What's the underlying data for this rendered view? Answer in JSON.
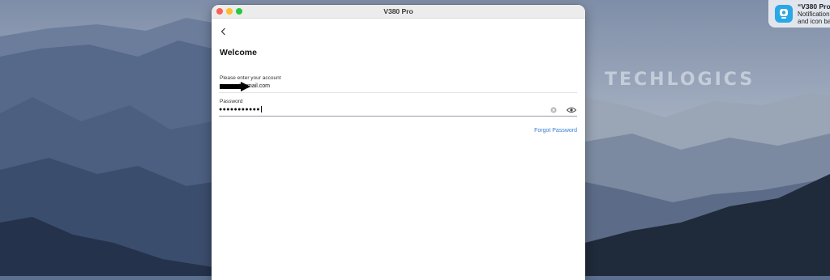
{
  "watermark": "TECHLOGICS",
  "notification": {
    "title": "“V380 Pro”",
    "line1": "Notification",
    "line2": "and icon ba"
  },
  "window": {
    "title": "V380 Pro"
  },
  "login": {
    "heading": "Welcome",
    "account_label": "Please enter your account",
    "account_value": "@gmail.com",
    "password_label": "Password",
    "password_value": "●●●●●●●●●●●",
    "forgot_label": "Forgot Password"
  },
  "icons": {
    "back": "chevron-left-icon",
    "clear": "clear-circle-icon",
    "reveal": "eye-icon",
    "notification_app": "camera-app-icon"
  },
  "colors": {
    "accent_link": "#3b7fd0",
    "traffic_red": "#fe5f57",
    "traffic_yellow": "#febc2e",
    "traffic_green": "#28c840"
  }
}
